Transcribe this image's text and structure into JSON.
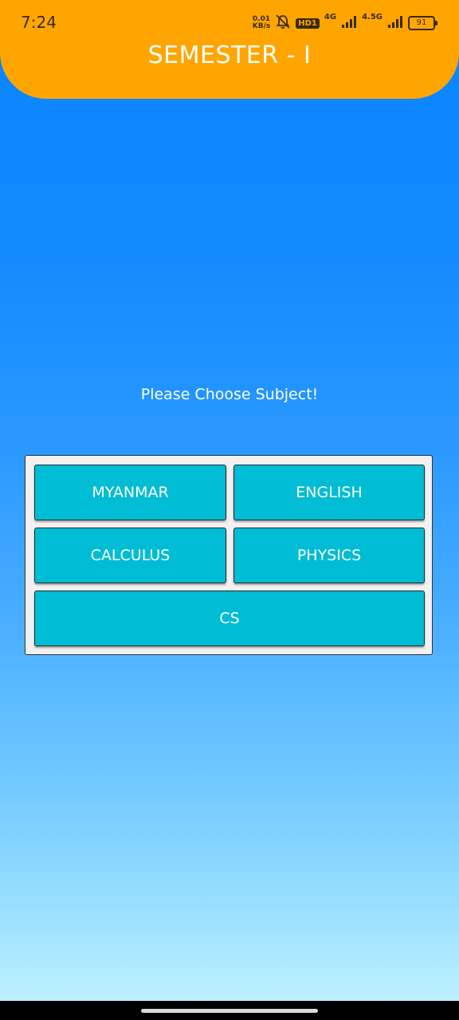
{
  "status_bar": {
    "time": "7:24",
    "net_speed_value": "0.01",
    "net_speed_unit": "KB/s",
    "icons": [
      "bell-off-icon",
      "hd-badge",
      "signal-icon",
      "signal-icon",
      "battery-icon"
    ],
    "hd_label": "HD1",
    "network_1": "4G",
    "network_2": "4.5G",
    "battery_level": "91"
  },
  "header": {
    "title": "SEMESTER - I",
    "color": "#ffa502"
  },
  "main": {
    "prompt": "Please Choose Subject!",
    "subjects": [
      {
        "label": "MYANMAR"
      },
      {
        "label": "ENGLISH"
      },
      {
        "label": "CALCULUS"
      },
      {
        "label": "PHYSICS"
      },
      {
        "label": "CS"
      }
    ],
    "button_color": "#00bcd4"
  }
}
